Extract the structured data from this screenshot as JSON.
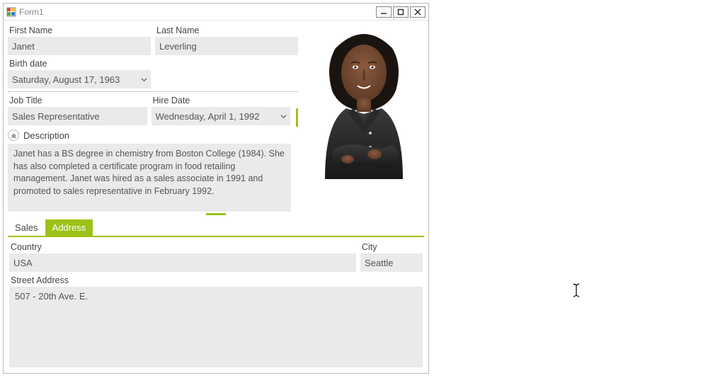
{
  "window": {
    "title": "Form1"
  },
  "fields": {
    "first_name_label": "First Name",
    "first_name_value": "Janet",
    "last_name_label": "Last Name",
    "last_name_value": "Leverling",
    "birth_date_label": "Birth date",
    "birth_date_value": "Saturday, August 17, 1963",
    "job_title_label": "Job Title",
    "job_title_value": "Sales Representative",
    "hire_date_label": "Hire Date",
    "hire_date_value": "Wednesday, April 1, 1992",
    "description_label": "Description",
    "description_value": "Janet has a BS degree in chemistry from Boston College (1984).  She has also completed a certificate program in food retailing management. Janet was hired as a sales associate in 1991 and promoted to sales representative in February 1992."
  },
  "tabs": {
    "sales": "Sales",
    "address": "Address"
  },
  "address": {
    "country_label": "Country",
    "country_value": "USA",
    "city_label": "City",
    "city_value": "Seattle",
    "street_label": "Street Address",
    "street_value": "507 - 20th Ave. E."
  },
  "accent_color": "#9cc117"
}
